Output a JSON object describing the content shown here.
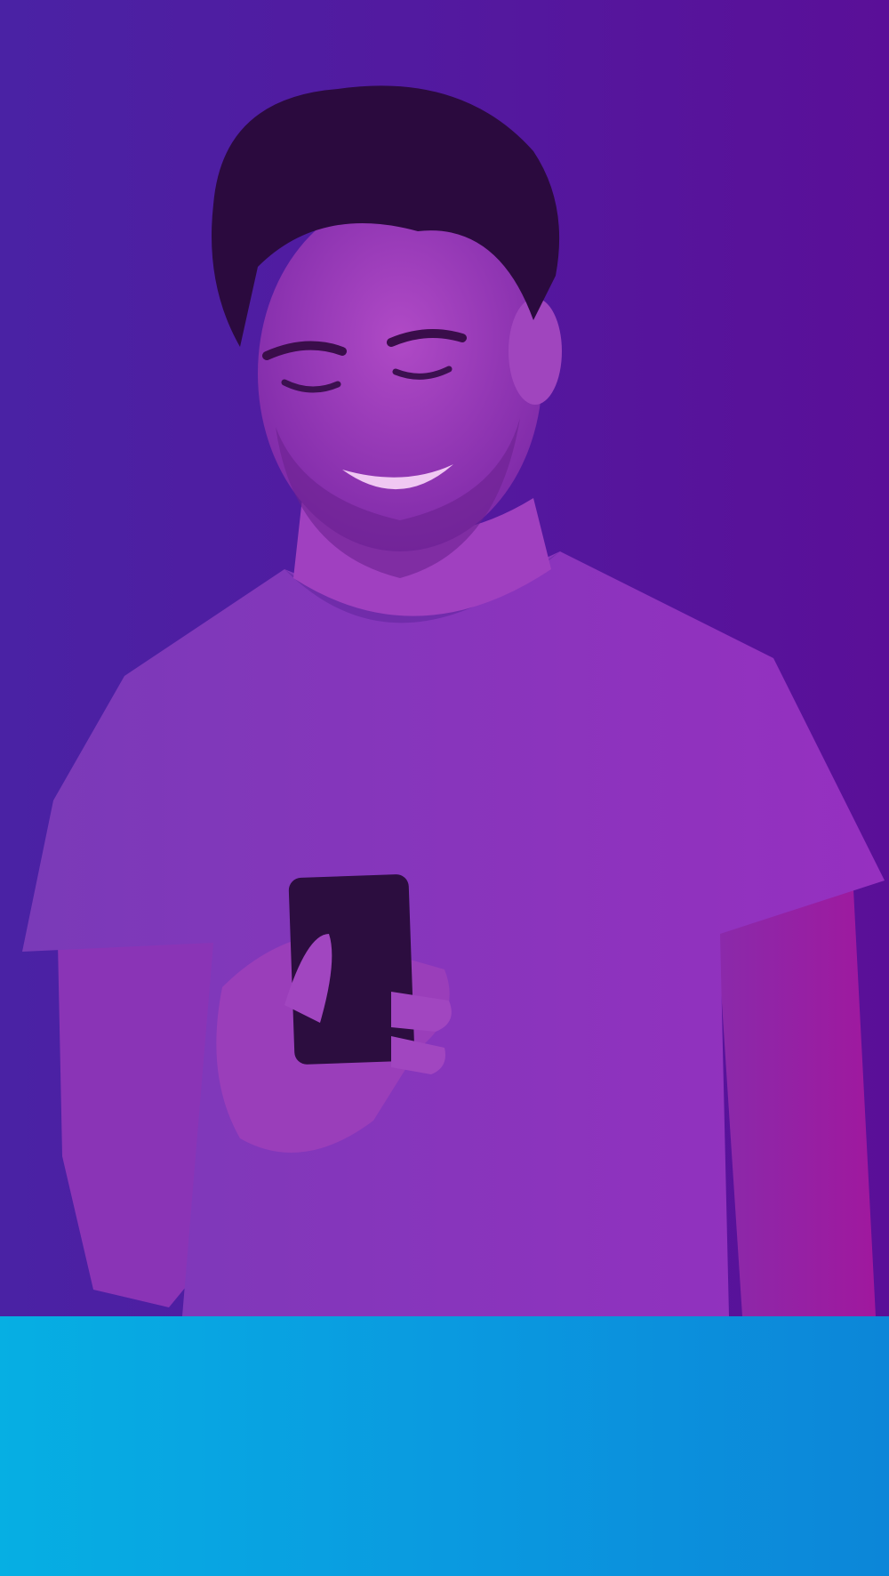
{
  "hero": {
    "background_start": "#4a22a4",
    "background_end": "#5a0f98",
    "overlay_color": "#8d2ec2",
    "text_fragment": "",
    "photo": "smiling-man-looking-at-phone"
  },
  "footer_band": {
    "color_start": "#06afe3",
    "color_end": "#0c86d8"
  }
}
